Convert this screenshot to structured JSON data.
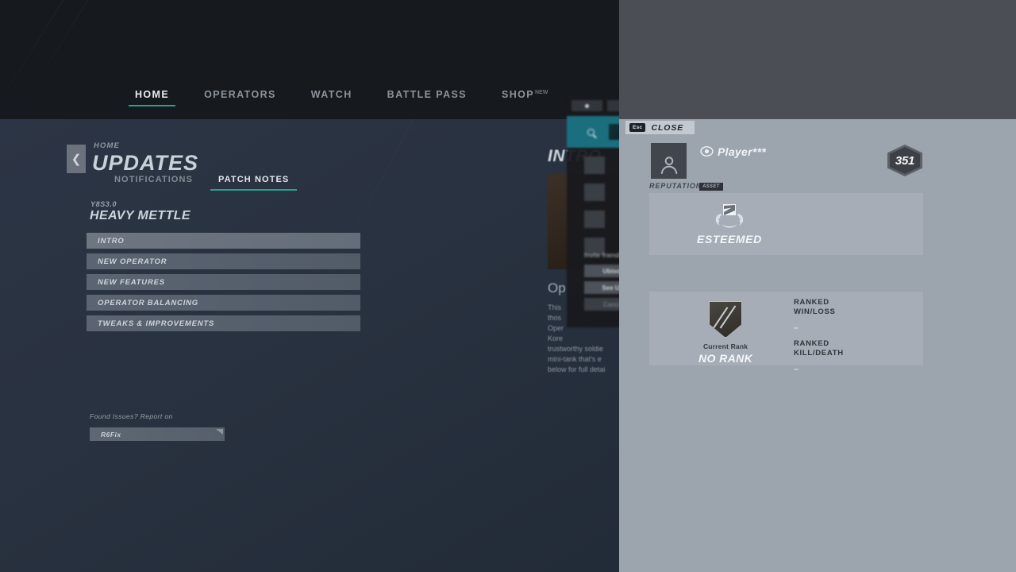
{
  "nav": {
    "items": [
      {
        "label": "HOME",
        "active": true
      },
      {
        "label": "OPERATORS",
        "active": false
      },
      {
        "label": "WATCH",
        "active": false
      },
      {
        "label": "BATTLE PASS",
        "active": false
      },
      {
        "label": "SHOP",
        "active": false
      }
    ],
    "shop_superscript": "NEW"
  },
  "page": {
    "back_icon": "chevron-left-icon",
    "breadcrumb": "HOME",
    "title": "UPDATES",
    "tabs": [
      {
        "label": "NOTIFICATIONS",
        "active": false
      },
      {
        "label": "PATCH NOTES",
        "active": true
      }
    ],
    "season_version": "Y8S3.0",
    "season_name": "HEAVY METTLE",
    "notes": [
      "INTRO",
      "NEW OPERATOR",
      "NEW FEATURES",
      "OPERATOR BALANCING",
      "TWEAKS & IMPROVEMENTS"
    ],
    "report_label": "Found Issues? Report on",
    "report_button": "R6Fix"
  },
  "article": {
    "heading": "INTRO",
    "subheading": "Op",
    "body_lines": [
      "This",
      "thos",
      "Oper",
      "Kore",
      "trustworthy soldie",
      "mini-tank that's e",
      "below for full detai"
    ]
  },
  "dialog": {
    "invite_label": "Invite friends",
    "buttons": [
      "Ubisoft",
      "See Ubi",
      "Cancel"
    ]
  },
  "overlay": {
    "close": {
      "key": "Esc",
      "label": "CLOSE"
    },
    "avatar_icon": "person-icon",
    "privacy_icon": "eye-icon",
    "player_name": "Player***",
    "level": "351",
    "reputation": {
      "label": "REPUTATION",
      "tag": "ASSET",
      "badge_icon": "laurel-wreath-icon",
      "value": "ESTEEMED"
    },
    "rank": {
      "icon": "shield-no-rank-icon",
      "caption": "Current Rank",
      "value": "NO RANK"
    },
    "stats": [
      {
        "label": "RANKED\nWIN/LOSS",
        "label_line1": "RANKED",
        "label_line2": "WIN/LOSS",
        "value": "–"
      },
      {
        "label": "RANKED\nKILL/DEATH",
        "label_line1": "RANKED",
        "label_line2": "KILL/DEATH",
        "value": "–"
      }
    ]
  },
  "colors": {
    "accent_teal": "#2e9e8f",
    "header_dark": "#16191d",
    "content_navy": "#2a3342",
    "overlay_gray": "#9ca4ae",
    "overlay_top_gray": "#4b4e54",
    "card_gray": "#a6adb6"
  }
}
